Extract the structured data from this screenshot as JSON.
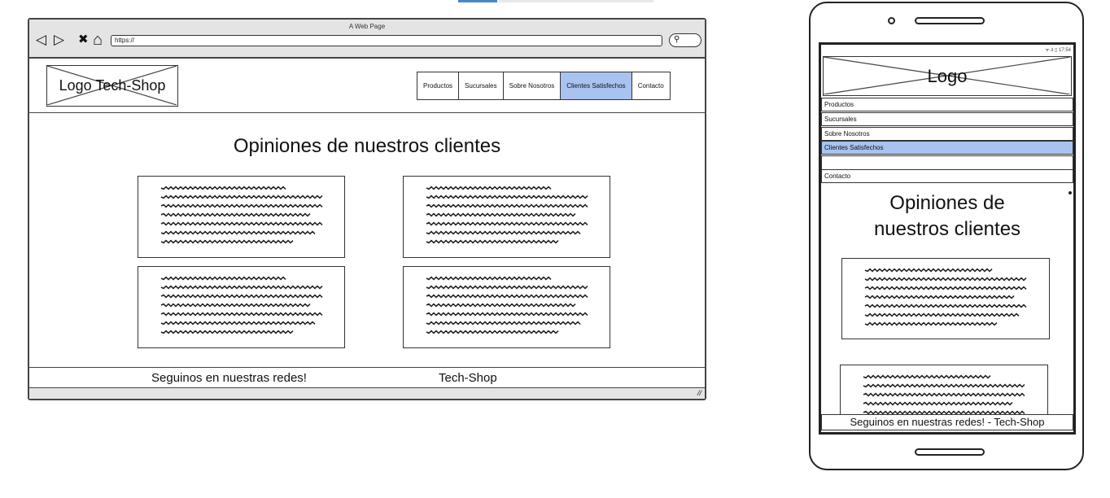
{
  "desktop": {
    "window_title": "A Web Page",
    "url": "https://",
    "nav_icons": {
      "back": "◁",
      "forward": "▷",
      "close": "✖",
      "home": "⌂"
    },
    "search_icon": "⚲",
    "logo": "Logo Tech-Shop",
    "nav": [
      {
        "label": "Productos",
        "active": false
      },
      {
        "label": "Sucursales",
        "active": false
      },
      {
        "label": "Sobre Nosotros",
        "active": false
      },
      {
        "label": "Clientes Satisfechos",
        "active": true
      },
      {
        "label": "Contacto",
        "active": false
      }
    ],
    "title": "Opiniones de nuestros clientes",
    "footer_left": "Seguinos en nuestras redes!",
    "footer_right": "Tech-Shop",
    "resize_grip": "//"
  },
  "mobile": {
    "status": "ᯤ.ıl ▯ 17:54",
    "logo": "Logo",
    "nav": [
      {
        "label": "Productos",
        "active": false
      },
      {
        "label": "Sucursales",
        "active": false
      },
      {
        "label": "Sobre Nosotros",
        "active": false
      },
      {
        "label": "Clientes Satisfechos",
        "active": true
      },
      {
        "label": "Contacto",
        "active": false
      }
    ],
    "title_line1": "Opiniones de",
    "title_line2": "nuestros clientes",
    "footer": "Seguinos en nuestras redes! - Tech-Shop"
  },
  "colors": {
    "active_nav": "#a8c3f0",
    "chrome_bg": "#e4e4e4",
    "stroke": "#333333"
  }
}
